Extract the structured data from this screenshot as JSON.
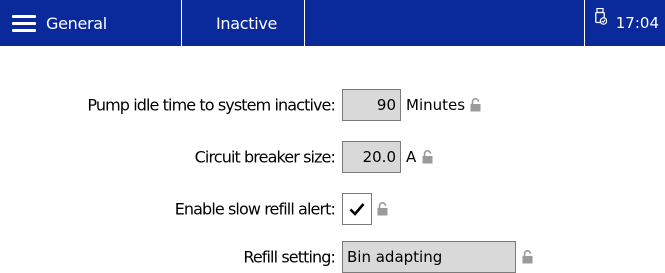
{
  "header": {
    "menu_label": "General",
    "status_label": "Inactive",
    "time": "17:04",
    "accent_color": "#0a2a9c"
  },
  "icons": {
    "menu": "hamburger-icon",
    "device": "usb-drive-icon",
    "lock": "lock-icon",
    "check": "checkmark-icon"
  },
  "settings": {
    "pump_idle": {
      "label": "Pump idle time to system inactive:",
      "value": "90",
      "unit": "Minutes"
    },
    "breaker": {
      "label": "Circuit breaker size:",
      "value": "20.0",
      "unit": "A"
    },
    "slow_refill": {
      "label": "Enable slow refill alert:",
      "checked": true
    },
    "refill": {
      "label": "Refill setting:",
      "value": "Bin adapting"
    }
  }
}
